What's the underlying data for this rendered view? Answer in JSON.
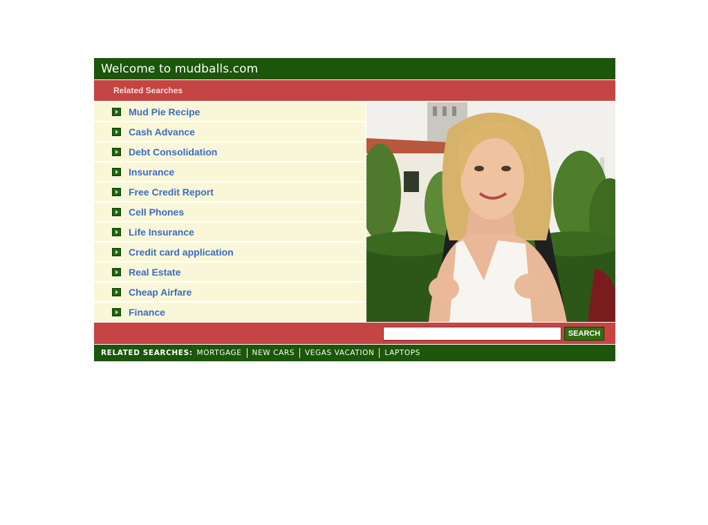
{
  "header": {
    "title": "Welcome to mudballs.com"
  },
  "related_header": {
    "label": "Related Searches"
  },
  "links": [
    {
      "label": "Mud Pie Recipe"
    },
    {
      "label": "Cash Advance"
    },
    {
      "label": "Debt Consolidation"
    },
    {
      "label": "Insurance"
    },
    {
      "label": "Free Credit Report"
    },
    {
      "label": "Cell Phones"
    },
    {
      "label": "Life Insurance"
    },
    {
      "label": "Credit card application"
    },
    {
      "label": "Real Estate"
    },
    {
      "label": "Cheap Airfare"
    },
    {
      "label": "Finance"
    }
  ],
  "search": {
    "value": "",
    "button_label": "SEARCH"
  },
  "footer": {
    "label": "RELATED SEARCHES:",
    "links": [
      {
        "label": "MORTGAGE"
      },
      {
        "label": "NEW CARS"
      },
      {
        "label": "VEGAS VACATION"
      },
      {
        "label": "LAPTOPS"
      }
    ]
  },
  "colors": {
    "green_bar": "#1b560a",
    "red_bar": "#c44543",
    "link_row_bg": "#f9f7d8",
    "link_text": "#3b6cc0",
    "button_green": "#2f6e12"
  }
}
